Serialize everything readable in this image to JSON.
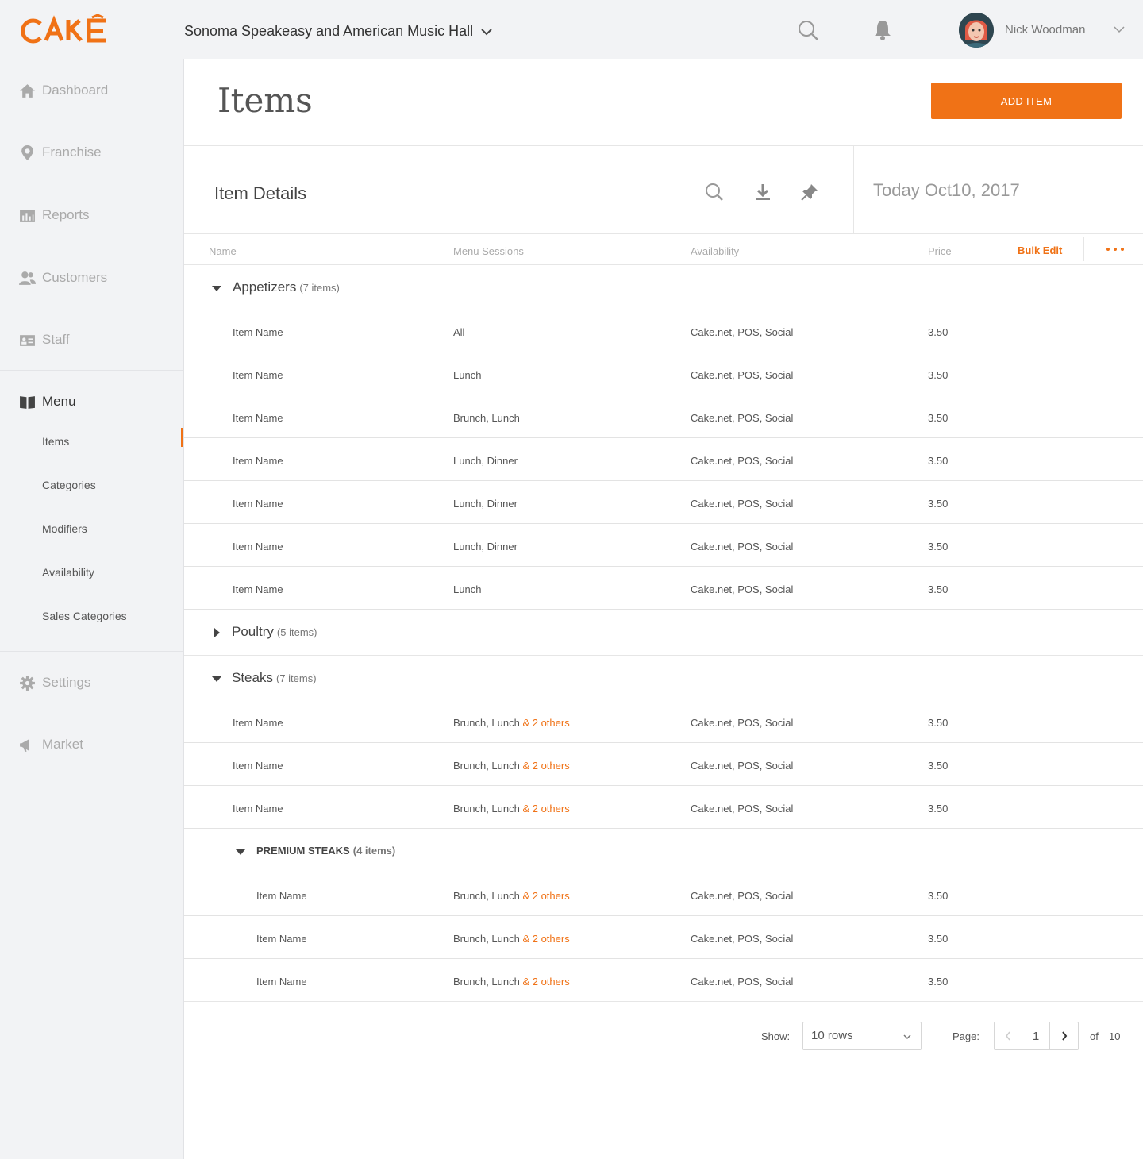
{
  "brand": {
    "logo_text": "CAKE",
    "accent": "#f07216"
  },
  "header": {
    "venue": "Sonoma Speakeasy and American Music Hall",
    "user_name": "Nick Woodman"
  },
  "sidebar": {
    "items": [
      {
        "label": "Dashboard",
        "icon": "home-icon"
      },
      {
        "label": "Franchise",
        "icon": "map-pin-icon"
      },
      {
        "label": "Reports",
        "icon": "bar-chart-icon"
      },
      {
        "label": "Customers",
        "icon": "users-icon"
      },
      {
        "label": "Staff",
        "icon": "id-card-icon"
      },
      {
        "label": "Menu",
        "icon": "book-icon"
      },
      {
        "label": "Settings",
        "icon": "gear-icon"
      },
      {
        "label": "Market",
        "icon": "megaphone-icon"
      }
    ],
    "menu_sub": [
      "Items",
      "Categories",
      "Modifiers",
      "Availability",
      "Sales Categories"
    ],
    "active_sub": "Items"
  },
  "page": {
    "title": "Items",
    "add_button": "ADD ITEM",
    "section_title": "Item Details",
    "date": "Today Oct10, 2017"
  },
  "table": {
    "columns": [
      "Name",
      "Menu Sessions",
      "Availability",
      "Price"
    ],
    "bulk_edit": "Bulk Edit",
    "groups": [
      {
        "name": "Appetizers",
        "count": "(7 items)",
        "expanded": true,
        "rows": [
          {
            "name": "Item Name",
            "sessions": "All",
            "others": "",
            "availability": "Cake.net, POS, Social",
            "price": "3.50"
          },
          {
            "name": "Item Name",
            "sessions": "Lunch",
            "others": "",
            "availability": "Cake.net, POS, Social",
            "price": "3.50"
          },
          {
            "name": "Item Name",
            "sessions": "Brunch, Lunch",
            "others": "",
            "availability": "Cake.net, POS, Social",
            "price": "3.50"
          },
          {
            "name": "Item Name",
            "sessions": "Lunch, Dinner",
            "others": "",
            "availability": "Cake.net, POS, Social",
            "price": "3.50"
          },
          {
            "name": "Item Name",
            "sessions": "Lunch, Dinner",
            "others": "",
            "availability": "Cake.net, POS, Social",
            "price": "3.50"
          },
          {
            "name": "Item Name",
            "sessions": "Lunch, Dinner",
            "others": "",
            "availability": "Cake.net, POS, Social",
            "price": "3.50"
          },
          {
            "name": "Item Name",
            "sessions": "Lunch",
            "others": "",
            "availability": "Cake.net, POS, Social",
            "price": "3.50"
          }
        ]
      },
      {
        "name": "Poultry",
        "count": "(5 items)",
        "expanded": false,
        "rows": []
      },
      {
        "name": "Steaks",
        "count": "(7 items)",
        "expanded": true,
        "rows": [
          {
            "name": "Item Name",
            "sessions": "Brunch, Lunch ",
            "others": "& 2 others",
            "availability": "Cake.net, POS, Social",
            "price": "3.50"
          },
          {
            "name": "Item Name",
            "sessions": "Brunch, Lunch ",
            "others": "& 2 others",
            "availability": "Cake.net, POS, Social",
            "price": "3.50"
          },
          {
            "name": "Item Name",
            "sessions": "Brunch, Lunch ",
            "others": "& 2 others",
            "availability": "Cake.net, POS, Social",
            "price": "3.50"
          }
        ],
        "subgroup": {
          "name": "PREMIUM STEAKS",
          "count": "(4 items)",
          "rows": [
            {
              "name": "Item Name",
              "sessions": "Brunch, Lunch ",
              "others": "& 2 others",
              "availability": "Cake.net, POS, Social",
              "price": "3.50"
            },
            {
              "name": "Item Name",
              "sessions": "Brunch, Lunch ",
              "others": "& 2 others",
              "availability": "Cake.net, POS, Social",
              "price": "3.50"
            },
            {
              "name": "Item Name",
              "sessions": "Brunch, Lunch ",
              "others": "& 2 others",
              "availability": "Cake.net, POS, Social",
              "price": "3.50"
            }
          ]
        }
      }
    ]
  },
  "footer": {
    "show_label": "Show:",
    "rows_value": "10 rows",
    "page_label": "Page:",
    "page_value": "1",
    "of_label": "of",
    "total_pages": "10"
  }
}
